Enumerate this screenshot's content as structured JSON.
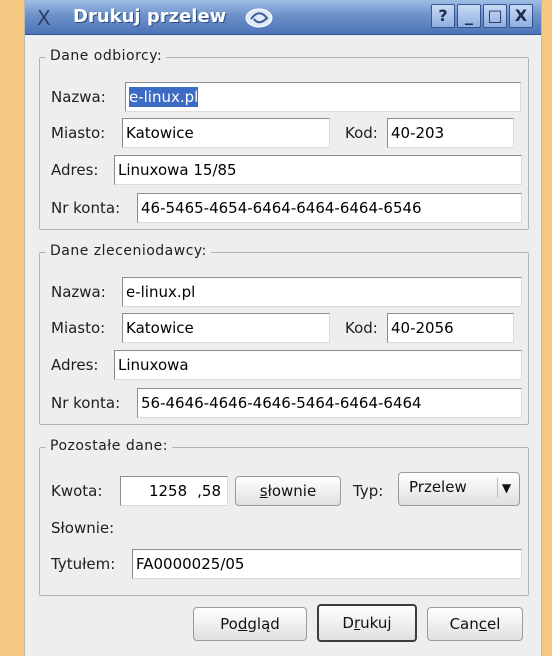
{
  "window": {
    "title": "Drukuj przelew",
    "controls": {
      "help": "?",
      "minimize": "_",
      "maximize": "□",
      "close": "X"
    },
    "system_menu": "X"
  },
  "odbiorca": {
    "group_label": "Dane odbiorcy:",
    "nazwa": {
      "label": "Nazwa:",
      "value": "e-linux.pl"
    },
    "miasto": {
      "label": "Miasto:",
      "value": "Katowice"
    },
    "kod": {
      "label": "Kod:",
      "value": "40-203"
    },
    "adres": {
      "label": "Adres:",
      "value": "Linuxowa 15/85"
    },
    "konto": {
      "label": "Nr konta:",
      "value": "46-5465-4654-6464-6464-6464-6546"
    }
  },
  "zleceniodawca": {
    "group_label": "Dane zleceniodawcy:",
    "nazwa": {
      "label": "Nazwa:",
      "value": "e-linux.pl"
    },
    "miasto": {
      "label": "Miasto:",
      "value": "Katowice"
    },
    "kod": {
      "label": "Kod:",
      "value": "40-2056"
    },
    "adres": {
      "label": "Adres:",
      "value": "Linuxowa"
    },
    "konto": {
      "label": "Nr konta:",
      "value": "56-4646-4646-4646-5464-6464-6464"
    }
  },
  "pozostale": {
    "group_label": "Pozostałe dane:",
    "kwota": {
      "label": "Kwota:",
      "zl": "1258",
      "gr": ",58"
    },
    "slownie_button": {
      "pre": "",
      "key": "s",
      "post": "łownie"
    },
    "typ": {
      "label": "Typ:",
      "value": "Przelew"
    },
    "slownie_label": "Słownie:",
    "tytulem": {
      "label": "Tytułem:",
      "value": "FA0000025/05"
    }
  },
  "buttons": {
    "podglad": {
      "pre": "Po",
      "key": "d",
      "post": "gląd"
    },
    "drukuj": {
      "pre": "D",
      "key": "r",
      "post": "ukuj"
    },
    "cancel": {
      "pre": "Can",
      "key": "c",
      "post": "el"
    }
  },
  "colors": {
    "desktop": "#f6c983",
    "titlebar": "#6d91c9",
    "selection": "#3c6cc4",
    "dialog": "#eeeeee"
  }
}
